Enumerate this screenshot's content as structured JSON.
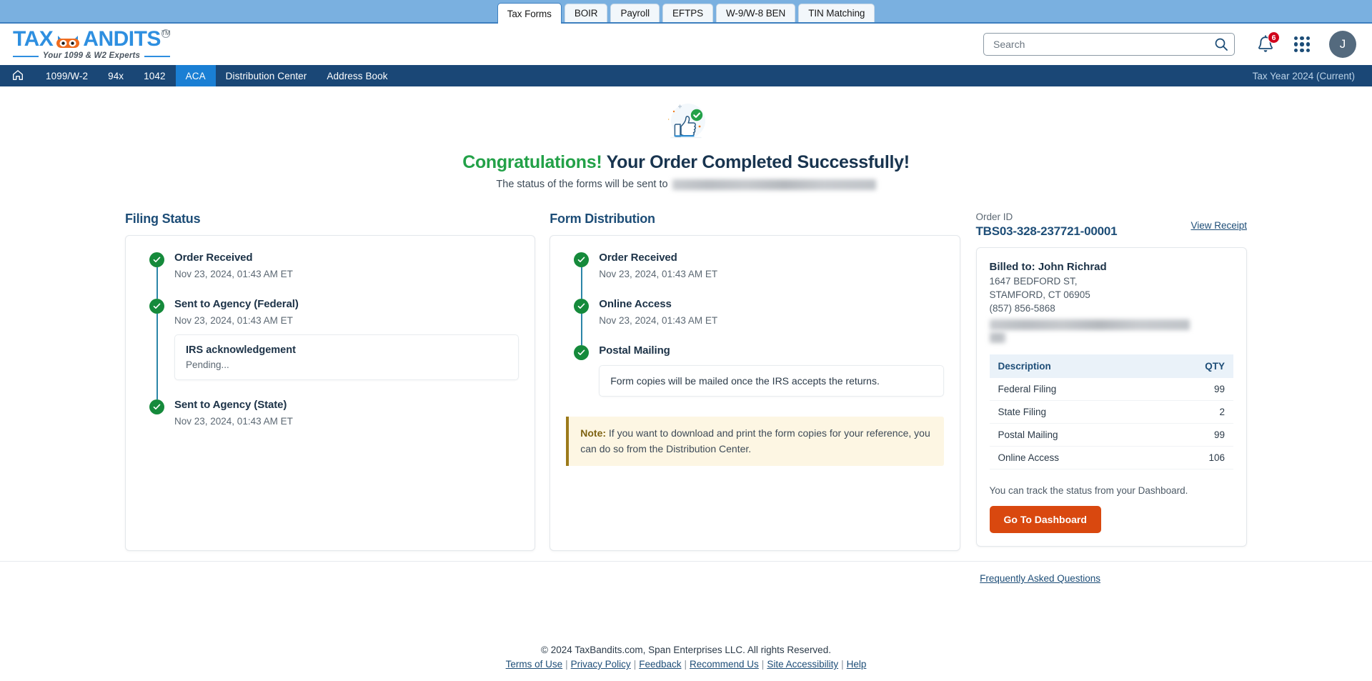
{
  "browser_tabs": [
    {
      "label": "Tax Forms",
      "active": true
    },
    {
      "label": "BOIR",
      "active": false
    },
    {
      "label": "Payroll",
      "active": false
    },
    {
      "label": "EFTPS",
      "active": false
    },
    {
      "label": "W-9/W-8 BEN",
      "active": false
    },
    {
      "label": "TIN Matching",
      "active": false
    }
  ],
  "header": {
    "logo_text": "TAX",
    "logo_text2": "ANDITS",
    "logo_tm": "TM",
    "logo_tagline": "Your 1099 & W2 Experts",
    "search": {
      "value": "",
      "placeholder": "Search",
      "icon": "search-icon"
    },
    "notification_count": "6",
    "apps_icon": "apps-grid-icon",
    "avatar_initial": "J"
  },
  "nav": {
    "home_icon": "home-icon",
    "items": [
      {
        "label": "1099/W-2",
        "active": false
      },
      {
        "label": "94x",
        "active": false
      },
      {
        "label": "1042",
        "active": false
      },
      {
        "label": "ACA",
        "active": true
      },
      {
        "label": "Distribution Center",
        "active": false
      },
      {
        "label": "Address Book",
        "active": false
      }
    ],
    "tax_year": "Tax Year 2024 (Current)"
  },
  "hero": {
    "icon": "thumbs-up-success-icon",
    "title_green": "Congratulations!",
    "title_navy": "Your Order Completed Successfully!",
    "subtitle_prefix": "The status of the forms will be sent to",
    "subtitle_email_redacted": true
  },
  "filing_status": {
    "heading": "Filing Status",
    "steps": [
      {
        "title": "Order Received",
        "date": "Nov 23, 2024, 01:43 AM ET"
      },
      {
        "title": "Sent to Agency (Federal)",
        "date": "Nov 23, 2024, 01:43 AM ET",
        "sub": {
          "title": "IRS acknowledgement",
          "text": "Pending..."
        }
      },
      {
        "title": "Sent to Agency (State)",
        "date": "Nov 23, 2024, 01:43 AM ET"
      }
    ]
  },
  "form_distribution": {
    "heading": "Form Distribution",
    "steps": [
      {
        "title": "Order Received",
        "date": "Nov 23, 2024, 01:43 AM ET"
      },
      {
        "title": "Online Access",
        "date": "Nov 23, 2024, 01:43 AM ET"
      },
      {
        "title": "Postal Mailing",
        "sub_plain": "Form copies will be mailed once the IRS accepts the returns."
      }
    ],
    "note_label": "Note:",
    "note_text": "If you want to download and print the form copies for your reference, you can do so from the Distribution Center."
  },
  "order": {
    "order_id_label": "Order ID",
    "order_id_value": "TBS03-328-237721-00001",
    "view_receipt": "View Receipt",
    "billed_to": "Billed to: John Richrad",
    "address_line1": "1647 BEDFORD ST,",
    "address_line2": "STAMFORD, CT 06905",
    "phone": "(857) 856-5868",
    "email_redacted": true,
    "table": {
      "headers": [
        "Description",
        "QTY"
      ],
      "rows": [
        {
          "description": "Federal Filing",
          "qty": "99"
        },
        {
          "description": "State Filing",
          "qty": "2"
        },
        {
          "description": "Postal Mailing",
          "qty": "99"
        },
        {
          "description": "Online Access",
          "qty": "106"
        }
      ]
    },
    "track_text": "You can track the status from your Dashboard.",
    "dashboard_button": "Go To Dashboard"
  },
  "faq_link": "Frequently Asked Questions",
  "footer": {
    "copyright": "© 2024 TaxBandits.com, Span Enterprises LLC. All rights Reserved.",
    "links": [
      "Terms of Use",
      "Privacy Policy",
      "Feedback",
      "Recommend Us",
      "Site Accessibility",
      "Help"
    ]
  },
  "colors": {
    "accent_blue": "#1a7fd4",
    "nav_navy": "#1a4776",
    "success_green": "#158a3b",
    "heading_navy": "#1d4d77",
    "cta_orange": "#d9480f",
    "note_bg": "#fdf6e3",
    "note_bar": "#9c7a1a",
    "timeline_line": "#2b85a8",
    "badge_red": "#d0021b"
  }
}
